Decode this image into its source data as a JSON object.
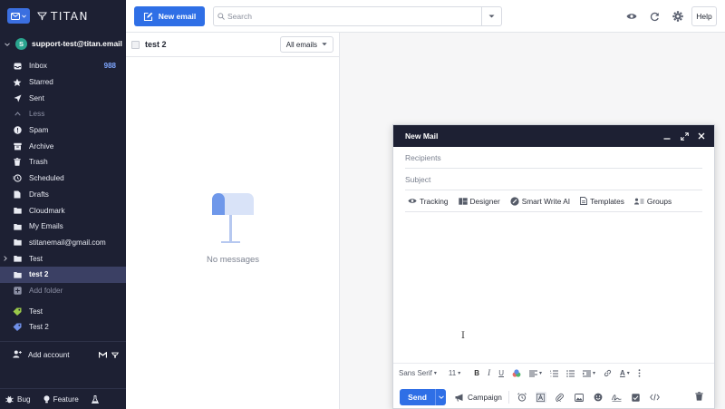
{
  "sidebar": {
    "logo": "TITAN",
    "account": {
      "initial": "S",
      "email": "support-test@titan.email"
    },
    "folders": [
      {
        "label": "Inbox",
        "count": "988"
      },
      {
        "label": "Starred"
      },
      {
        "label": "Sent"
      },
      {
        "label": "Less"
      },
      {
        "label": "Spam"
      },
      {
        "label": "Archive"
      },
      {
        "label": "Trash"
      },
      {
        "label": "Scheduled"
      },
      {
        "label": "Drafts"
      },
      {
        "label": "Cloudmark"
      },
      {
        "label": "My Emails"
      },
      {
        "label": "stitanemail@gmail.com"
      },
      {
        "label": "Test"
      },
      {
        "label": "test 2"
      },
      {
        "label": "Add folder"
      }
    ],
    "labels": [
      {
        "label": "Test",
        "color": "#9ac94a"
      },
      {
        "label": "Test 2",
        "color": "#6f8fe8"
      }
    ],
    "add_account": "Add account",
    "bottom": {
      "bug": "Bug",
      "feature": "Feature"
    }
  },
  "topbar": {
    "new_email": "New email",
    "search_placeholder": "Search",
    "help": "Help"
  },
  "message_list": {
    "title": "test 2",
    "filter": "All emails",
    "empty_text": "No messages"
  },
  "compose": {
    "title": "New Mail",
    "recipients_placeholder": "Recipients",
    "subject_placeholder": "Subject",
    "tools": [
      "Tracking",
      "Designer",
      "Smart Write AI",
      "Templates",
      "Groups"
    ],
    "font_family": "Sans Serif",
    "font_size": "11",
    "send": "Send",
    "campaign": "Campaign"
  },
  "colors": {
    "accent": "#2f6fe6",
    "sidebar_bg": "#1d2033",
    "active_folder": "#3b4064"
  }
}
